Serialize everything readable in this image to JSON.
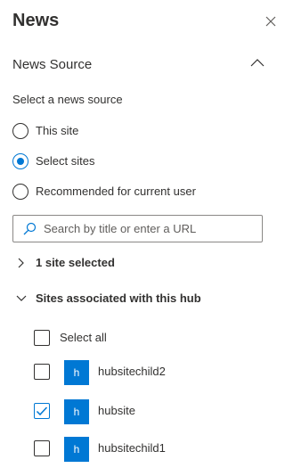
{
  "panel": {
    "title": "News",
    "close_icon": "close-icon"
  },
  "news_source": {
    "heading": "News Source",
    "collapse_icon": "chevron-up-icon",
    "prompt": "Select a news source",
    "options": [
      {
        "label": "This site",
        "checked": false
      },
      {
        "label": "Select sites",
        "checked": true
      },
      {
        "label": "Recommended for current user",
        "checked": false
      }
    ]
  },
  "search": {
    "placeholder": "Search by title or enter a URL",
    "value": "",
    "icon": "search-icon"
  },
  "selected_summary": {
    "label": "1 site selected",
    "expanded": false
  },
  "hub_sites": {
    "heading": "Sites associated with this hub",
    "expanded": true,
    "select_all_label": "Select all",
    "sites": [
      {
        "name": "hubsitechild2",
        "initial": "h",
        "checked": false
      },
      {
        "name": "hubsite",
        "initial": "h",
        "checked": true
      },
      {
        "name": "hubsitechild1",
        "initial": "h",
        "checked": false
      }
    ]
  },
  "colors": {
    "accent": "#0078d4",
    "text": "#323130",
    "border": "#8a8886"
  }
}
